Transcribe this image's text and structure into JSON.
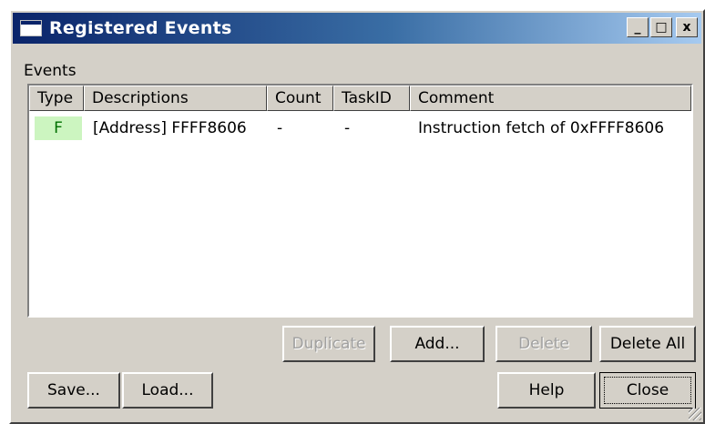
{
  "window": {
    "title": "Registered Events",
    "controls": {
      "minimize": "_",
      "maximize": "□",
      "close": "x"
    }
  },
  "events": {
    "group_label": "Events",
    "columns": [
      "Type",
      "Descriptions",
      "Count",
      "TaskID",
      "Comment"
    ],
    "rows": [
      {
        "type": "F",
        "description": "[Address] FFFF8606",
        "count": "-",
        "taskid": "-",
        "comment": "Instruction fetch of 0xFFFF8606"
      }
    ]
  },
  "buttons": {
    "duplicate": "Duplicate",
    "add": "Add...",
    "delete": "Delete",
    "delete_all": "Delete All",
    "save": "Save...",
    "load": "Load...",
    "help": "Help",
    "close": "Close"
  },
  "colors": {
    "title_gradient_start": "#0a246a",
    "title_gradient_end": "#a6caf0",
    "type_cell_bg": "#ccf5c0",
    "type_cell_text": "#007000"
  }
}
